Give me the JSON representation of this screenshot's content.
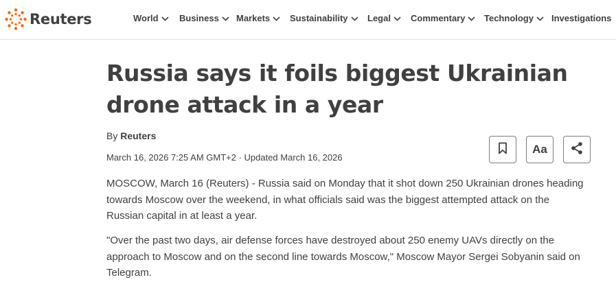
{
  "header": {
    "logo_text": "Reuters",
    "brand_color": "#fa6400",
    "nav": [
      {
        "label": "World",
        "has_dropdown": true
      },
      {
        "label": "Business",
        "has_dropdown": true
      },
      {
        "label": "Markets",
        "has_dropdown": true
      },
      {
        "label": "Sustainability",
        "has_dropdown": true
      },
      {
        "label": "Legal",
        "has_dropdown": true
      },
      {
        "label": "Commentary",
        "has_dropdown": true
      },
      {
        "label": "Technology",
        "has_dropdown": true
      },
      {
        "label": "Investigations",
        "has_dropdown": false
      }
    ]
  },
  "article": {
    "title": "Russia says it foils biggest Ukrainian drone attack in a year",
    "byline_prefix": "By",
    "author": "Reuters",
    "dateline": "March 16, 2026 7:25 AM GMT+2 · Updated March 16, 2026",
    "paragraphs": [
      "MOSCOW, March 16 (Reuters) - Russia said on Monday that it shot down 250 Ukrainian drones heading towards Moscow over the weekend, in what officials said was the biggest attempted attack on the Russian capital in at least a year.",
      "\"Over the past two days, air defense forces have destroyed about 250 enemy UAVs directly on the approach to Moscow and on the second line towards Moscow,\" Moscow Mayor Sergei Sobyanin said on Telegram."
    ]
  },
  "tools": {
    "bookmark_icon": "bookmark-icon",
    "text_size_label": "Aa",
    "share_icon": "share-icon"
  }
}
